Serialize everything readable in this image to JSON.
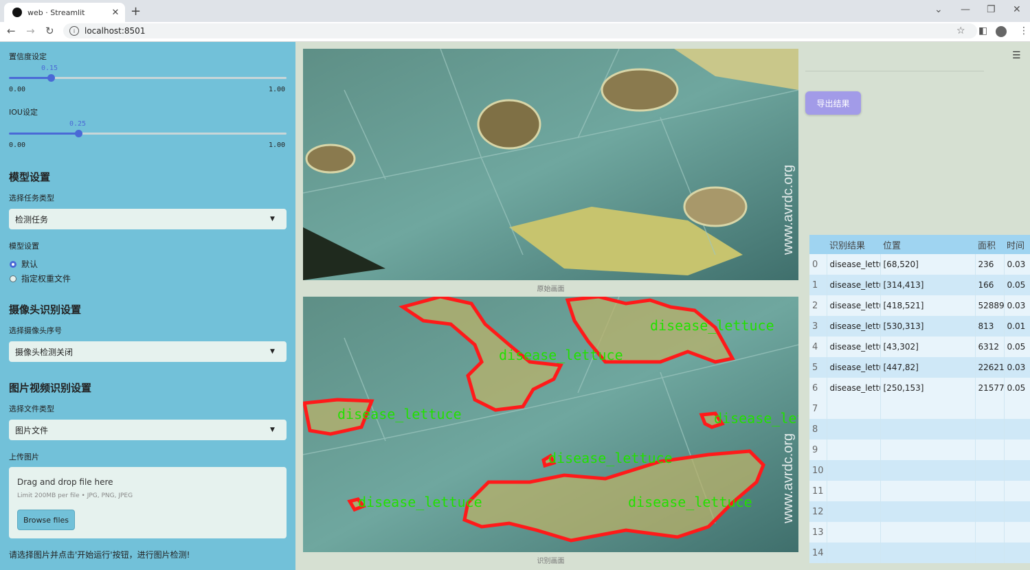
{
  "browser": {
    "tab_title": "web · Streamlit",
    "url": "localhost:8501"
  },
  "sidebar": {
    "confidence": {
      "label": "置信度设定",
      "value": "0.15",
      "min": "0.00",
      "max": "1.00",
      "fraction": 0.15
    },
    "iou": {
      "label": "IOU设定",
      "value": "0.25",
      "min": "0.00",
      "max": "1.00",
      "fraction": 0.25
    },
    "model_heading": "模型设置",
    "task_label": "选择任务类型",
    "task_value": "检测任务",
    "model_label": "模型设置",
    "model_options": [
      "默认",
      "指定权重文件"
    ],
    "model_selected": 0,
    "camera_heading": "摄像头识别设置",
    "camera_label": "选择摄像头序号",
    "camera_value": "摄像头检测关闭",
    "media_heading": "图片视频识别设置",
    "file_type_label": "选择文件类型",
    "file_type_value": "图片文件",
    "upload_label": "上传图片",
    "upload_drag": "Drag and drop file here",
    "upload_limit": "Limit 200MB per file • JPG, PNG, JPEG",
    "browse_label": "Browse files",
    "note": "请选择图片并点击'开始运行'按钮，进行图片检测!"
  },
  "main": {
    "original_caption": "原始画面",
    "result_caption": "识别画面",
    "export_label": "导出结果",
    "watermark": "www.avrdc.org",
    "detection_label": "disease_lettuce"
  },
  "table": {
    "headers": [
      "",
      "识别结果",
      "位置",
      "面积",
      "时间"
    ],
    "rows": [
      [
        "0",
        "disease_lettuce",
        "[68,520]",
        "236",
        "0.03"
      ],
      [
        "1",
        "disease_lettuce",
        "[314,413]",
        "166",
        "0.05"
      ],
      [
        "2",
        "disease_lettuce",
        "[418,521]",
        "52889",
        "0.03"
      ],
      [
        "3",
        "disease_lettuce",
        "[530,313]",
        "813",
        "0.01"
      ],
      [
        "4",
        "disease_lettuce",
        "[43,302]",
        "6312",
        "0.05"
      ],
      [
        "5",
        "disease_lettuce",
        "[447,82]",
        "22621",
        "0.03"
      ],
      [
        "6",
        "disease_lettuce",
        "[250,153]",
        "21577",
        "0.05"
      ],
      [
        "7",
        "",
        "",
        "",
        ""
      ],
      [
        "8",
        "",
        "",
        "",
        ""
      ],
      [
        "9",
        "",
        "",
        "",
        ""
      ],
      [
        "10",
        "",
        "",
        "",
        ""
      ],
      [
        "11",
        "",
        "",
        "",
        ""
      ],
      [
        "12",
        "",
        "",
        "",
        ""
      ],
      [
        "13",
        "",
        "",
        "",
        ""
      ],
      [
        "14",
        "",
        "",
        "",
        ""
      ]
    ]
  },
  "colors": {
    "sidebar": "#72c1d9",
    "accent": "#4a69d6",
    "export_button": "#a29be8",
    "detection_outline": "#ff1a1a",
    "detection_text": "#22e000"
  }
}
